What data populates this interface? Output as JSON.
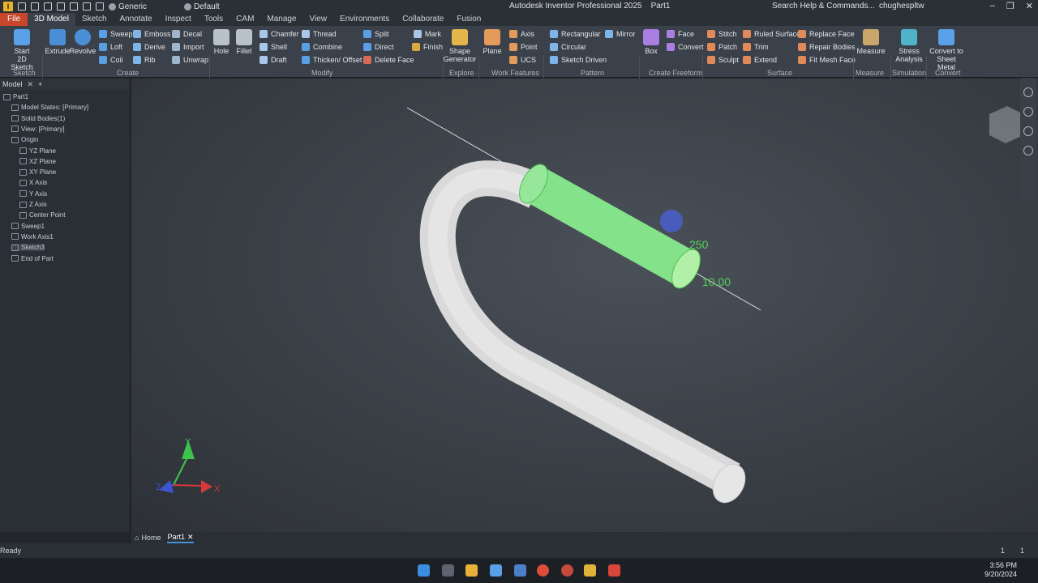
{
  "titlebar": {
    "style_combo": "Generic",
    "appearance_combo": "Default",
    "app_title": "Autodesk Inventor Professional 2025",
    "doc_title": "Part1",
    "search_help": "Search Help & Commands...",
    "user": "chughespltw"
  },
  "menu": [
    "File",
    "3D Model",
    "Sketch",
    "Annotate",
    "Inspect",
    "Tools",
    "CAM",
    "Manage",
    "View",
    "Environments",
    "Collaborate",
    "Fusion"
  ],
  "ribbon": {
    "sketch_start": "Start",
    "sketch_start2": "2D Sketch",
    "sketch_group": "Sketch",
    "extrude": "Extrude",
    "revolve": "Revolve",
    "sweep": "Sweep",
    "loft": "Loft",
    "coil": "Coil",
    "emboss": "Emboss",
    "derive": "Derive",
    "rib": "Rib",
    "decal": "Decal",
    "import": "Import",
    "unwrap": "Unwrap",
    "create_group": "Create",
    "hole": "Hole",
    "fillet": "Fillet",
    "chamfer": "Chamfer",
    "shell": "Shell",
    "draft": "Draft",
    "thread": "Thread",
    "combine": "Combine",
    "thicken": "Thicken/ Offset",
    "split": "Split",
    "direct": "Direct",
    "delete_face": "Delete Face",
    "mark": "Mark",
    "finish": "Finish",
    "modify_group": "Modify",
    "shape_gen1": "Shape",
    "shape_gen2": "Generator",
    "explore_group": "Explore",
    "plane": "Plane",
    "axis": "Axis",
    "point": "Point",
    "ucs": "UCS",
    "workfeatures_group": "Work Features",
    "rectangular": "Rectangular",
    "circular": "Circular",
    "sketch_driven": "Sketch Driven",
    "mirror": "Mirror",
    "pattern_group": "Pattern",
    "box": "Box",
    "face": "Face",
    "convert": "Convert",
    "freeform_group": "Create Freeform",
    "stitch": "Stitch",
    "patch": "Patch",
    "sculpt": "Sculpt",
    "ruled_surface": "Ruled Surface",
    "trim": "Trim",
    "extend": "Extend",
    "replace_face": "Replace Face",
    "repair_bodies": "Repair Bodies",
    "fit_mesh": "Fit Mesh Face",
    "surface_group": "Surface",
    "measure": "Measure",
    "measure_group": "Measure",
    "stress1": "Stress",
    "stress2": "Analysis",
    "simulation_group": "Simulation",
    "convert_sm1": "Convert to",
    "convert_sm2": "Sheet Metal",
    "convert_group": "Convert"
  },
  "browser": {
    "tab": "Model",
    "items": [
      {
        "label": "Part1",
        "level": 0
      },
      {
        "label": "Model States: [Primary]",
        "level": 1
      },
      {
        "label": "Solid Bodies(1)",
        "level": 1
      },
      {
        "label": "View: [Primary]",
        "level": 1
      },
      {
        "label": "Origin",
        "level": 1
      },
      {
        "label": "YZ Plane",
        "level": 2
      },
      {
        "label": "XZ Plane",
        "level": 2
      },
      {
        "label": "XY Plane",
        "level": 2
      },
      {
        "label": "X Axis",
        "level": 2
      },
      {
        "label": "Y Axis",
        "level": 2
      },
      {
        "label": "Z Axis",
        "level": 2
      },
      {
        "label": "Center Point",
        "level": 2
      },
      {
        "label": "Sweep1",
        "level": 1
      },
      {
        "label": "Work Axis1",
        "level": 1
      },
      {
        "label": "Sketch3",
        "level": 1
      },
      {
        "label": "End of Part",
        "level": 1
      }
    ]
  },
  "viewport": {
    "dim_length": "250",
    "dim_diameter": "10.00",
    "axis_x": "X",
    "axis_y": "Y",
    "axis_z": "Z"
  },
  "doc_tabs": {
    "home": "Home",
    "part": "Part1"
  },
  "status": {
    "ready": "Ready",
    "count1": "1",
    "count2": "1"
  },
  "clock": {
    "time": "3:56 PM",
    "date": "9/20/2024"
  }
}
